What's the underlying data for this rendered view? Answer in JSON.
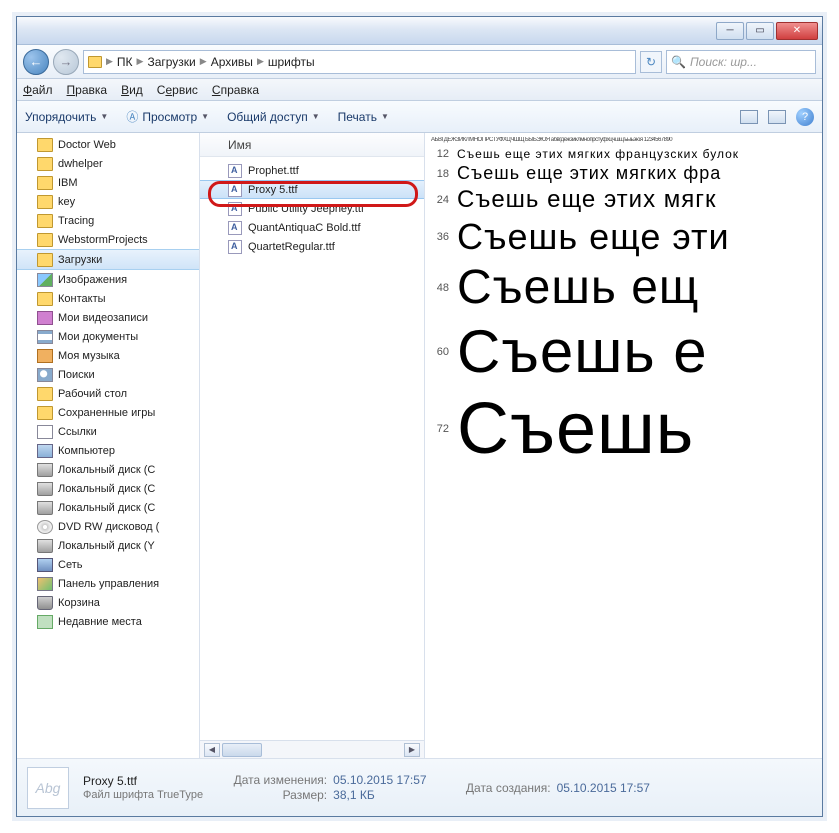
{
  "breadcrumbs": {
    "root": "ПК",
    "items": [
      "Загрузки",
      "Архивы",
      "шрифты"
    ]
  },
  "search": {
    "placeholder": "Поиск: шр..."
  },
  "menu": {
    "file": "Файл",
    "edit": "Правка",
    "view": "Вид",
    "tools": "Сервис",
    "help": "Справка"
  },
  "toolbar": {
    "organize": "Упорядочить",
    "preview": "Просмотр",
    "share": "Общий доступ",
    "print": "Печать"
  },
  "tree": [
    {
      "icon": "folder",
      "label": "Doctor Web"
    },
    {
      "icon": "folder",
      "label": "dwhelper"
    },
    {
      "icon": "folder",
      "label": "IBM"
    },
    {
      "icon": "folder",
      "label": "key"
    },
    {
      "icon": "folder",
      "label": "Tracing"
    },
    {
      "icon": "folder",
      "label": "WebstormProjects"
    },
    {
      "icon": "folder",
      "label": "Загрузки",
      "selected": true
    },
    {
      "icon": "img",
      "label": "Изображения"
    },
    {
      "icon": "folder",
      "label": "Контакты"
    },
    {
      "icon": "vid",
      "label": "Мои видеозаписи"
    },
    {
      "icon": "doc",
      "label": "Мои документы"
    },
    {
      "icon": "music",
      "label": "Моя музыка"
    },
    {
      "icon": "search",
      "label": "Поиски"
    },
    {
      "icon": "folder",
      "label": "Рабочий стол"
    },
    {
      "icon": "folder",
      "label": "Сохраненные игры"
    },
    {
      "icon": "link",
      "label": "Ссылки"
    },
    {
      "icon": "pc",
      "label": "Компьютер"
    },
    {
      "icon": "disk",
      "label": "Локальный диск (C"
    },
    {
      "icon": "disk",
      "label": "Локальный диск (C"
    },
    {
      "icon": "disk",
      "label": "Локальный диск (C"
    },
    {
      "icon": "dvd",
      "label": "DVD RW дисковод ("
    },
    {
      "icon": "disk",
      "label": "Локальный диск (Y"
    },
    {
      "icon": "net",
      "label": "Сеть"
    },
    {
      "icon": "panel",
      "label": "Панель управления"
    },
    {
      "icon": "trash",
      "label": "Корзина"
    },
    {
      "icon": "recent",
      "label": "Недавние места"
    }
  ],
  "filelist": {
    "header": "Имя",
    "files": [
      {
        "name": "Prophet.ttf"
      },
      {
        "name": "Proxy 5.ttf",
        "selected": true
      },
      {
        "name": "Public Utility Jeepney.ttf"
      },
      {
        "name": "QuantAntiquaC Bold.ttf"
      },
      {
        "name": "QuartetRegular.ttf"
      }
    ]
  },
  "preview": {
    "header": "АБВГДЕЖЗИКЛМНОПРСТУФХЦЧШЩЪЫЬЭЮЯ  абвгдежзиклмнопрстуфхцчшщъыьэюя  1234567890",
    "rows": [
      {
        "size": 12,
        "text": "Съешь еще этих мягких французских булок"
      },
      {
        "size": 18,
        "text": "Съешь еще этих мягких фра"
      },
      {
        "size": 24,
        "text": "Съешь еще этих мягк"
      },
      {
        "size": 36,
        "text": "Съешь еще эти"
      },
      {
        "size": 48,
        "text": "Съешь ещ"
      },
      {
        "size": 60,
        "text": "Съешь е"
      },
      {
        "size": 72,
        "text": "Съешь"
      }
    ]
  },
  "details": {
    "thumb": "Abg",
    "filename": "Proxy 5.ttf",
    "filetype": "Файл шрифта TrueType",
    "modified_label": "Дата изменения:",
    "modified_value": "05.10.2015 17:57",
    "size_label": "Размер:",
    "size_value": "38,1 КБ",
    "created_label": "Дата создания:",
    "created_value": "05.10.2015 17:57"
  }
}
